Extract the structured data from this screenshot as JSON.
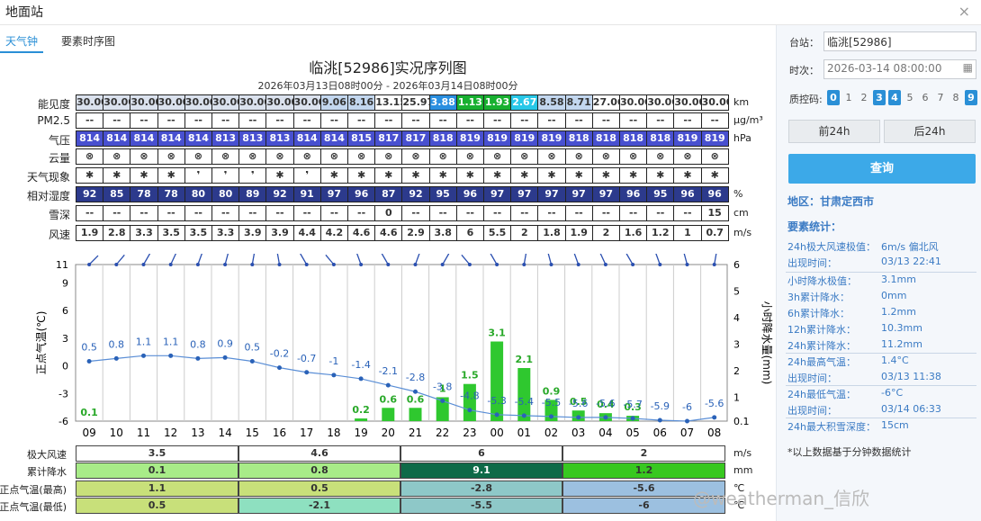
{
  "window": {
    "title": "地面站",
    "close": "×"
  },
  "tabs": [
    "天气钟",
    "要素时序图"
  ],
  "chart_title": "临洮[52986]实况序列图",
  "chart_subtitle": "2026年03月13日08时00分 - 2026年03月14日08时00分",
  "hours": [
    "09",
    "10",
    "11",
    "12",
    "13",
    "14",
    "15",
    "16",
    "17",
    "18",
    "19",
    "20",
    "21",
    "22",
    "23",
    "00",
    "01",
    "02",
    "03",
    "04",
    "05",
    "06",
    "07",
    "08"
  ],
  "rows": [
    {
      "label": "能见度",
      "unit": "km",
      "values": [
        "30.00",
        "30.00",
        "30.00",
        "30.00",
        "30.00",
        "30.00",
        "30.00",
        "30.00",
        "30.00",
        "9.06",
        "8.16",
        "13.15",
        "25.97",
        "3.88",
        "1.13",
        "1.93",
        "2.67",
        "8.58",
        "8.71",
        "27.06",
        "30.00",
        "30.00",
        "30.00",
        "30.00"
      ],
      "colors": [
        "#dbe2ee",
        "#dbe2ee",
        "#dbe2ee",
        "#dbe2ee",
        "#dbe2ee",
        "#dbe2ee",
        "#dbe2ee",
        "#dbe2ee",
        "#dbe2ee",
        "#c3d7ef",
        "#c3d7ef",
        "#ffffff",
        "#ffffff",
        "#2a8fe0",
        "#18b030",
        "#18b030",
        "#28c8e8",
        "#c3d7ef",
        "#c3d7ef",
        "#ffffff",
        "#ffffff",
        "#ffffff",
        "#ffffff",
        "#ffffff"
      ]
    },
    {
      "label": "PM2.5",
      "unit": "μg/m³",
      "values": [
        "--",
        "--",
        "--",
        "--",
        "--",
        "--",
        "--",
        "--",
        "--",
        "--",
        "--",
        "--",
        "--",
        "--",
        "--",
        "--",
        "--",
        "--",
        "--",
        "--",
        "--",
        "--",
        "--",
        "--"
      ]
    },
    {
      "label": "气压",
      "unit": "hPa",
      "values": [
        "814",
        "814",
        "814",
        "814",
        "814",
        "813",
        "813",
        "813",
        "814",
        "814",
        "815",
        "817",
        "817",
        "818",
        "819",
        "819",
        "819",
        "819",
        "818",
        "818",
        "818",
        "818",
        "819",
        "819"
      ],
      "fill": "#4850d0",
      "fg": "#fff"
    },
    {
      "label": "云量",
      "unit": "",
      "values": [
        "⊗",
        "⊗",
        "⊗",
        "⊗",
        "⊗",
        "⊗",
        "⊗",
        "⊗",
        "⊗",
        "⊗",
        "⊗",
        "⊗",
        "⊗",
        "⊗",
        "⊗",
        "⊗",
        "⊗",
        "⊗",
        "⊗",
        "⊗",
        "⊗",
        "⊗",
        "⊗",
        "⊗"
      ]
    },
    {
      "label": "天气现象",
      "unit": "",
      "values": [
        "✱",
        "✱",
        "✱",
        "✱",
        "❜",
        "❜",
        "❜",
        "✱",
        "❜",
        "✱",
        "✱",
        "✱",
        "✱",
        "✱",
        "✱",
        "✱",
        "✱",
        "✱",
        "✱",
        "✱",
        "✱",
        "✱",
        "✱",
        "✱"
      ]
    },
    {
      "label": "相对湿度",
      "unit": "%",
      "values": [
        "92",
        "85",
        "78",
        "78",
        "80",
        "80",
        "89",
        "92",
        "91",
        "97",
        "96",
        "87",
        "92",
        "95",
        "96",
        "97",
        "97",
        "97",
        "97",
        "97",
        "96",
        "95",
        "96",
        "96"
      ],
      "fill": "#2c3a8c",
      "fg": "#fff"
    },
    {
      "label": "雪深",
      "unit": "cm",
      "values": [
        "--",
        "--",
        "--",
        "--",
        "--",
        "--",
        "--",
        "--",
        "--",
        "--",
        "--",
        "0",
        "--",
        "--",
        "--",
        "--",
        "--",
        "--",
        "--",
        "--",
        "--",
        "--",
        "--",
        "15"
      ]
    },
    {
      "label": "风速",
      "unit": "m/s",
      "values": [
        "1.9",
        "2.8",
        "3.3",
        "3.5",
        "3.5",
        "3.3",
        "3.9",
        "3.9",
        "4.4",
        "4.2",
        "4.6",
        "4.6",
        "2.9",
        "3.8",
        "6",
        "5.5",
        "2",
        "1.8",
        "1.9",
        "2",
        "1.6",
        "1.2",
        "1",
        "0.7"
      ]
    }
  ],
  "chart_data": {
    "type": "line",
    "x": [
      "09",
      "10",
      "11",
      "12",
      "13",
      "14",
      "15",
      "16",
      "17",
      "18",
      "19",
      "20",
      "21",
      "22",
      "23",
      "00",
      "01",
      "02",
      "03",
      "04",
      "05",
      "06",
      "07",
      "08"
    ],
    "temperature": [
      0.5,
      0.8,
      1.1,
      1.1,
      0.8,
      0.9,
      0.5,
      -0.2,
      -0.7,
      -1,
      -1.4,
      -2.1,
      -2.8,
      -3.8,
      -4.8,
      -5.3,
      -5.4,
      -5.5,
      -5.6,
      -5.6,
      -5.7,
      -5.9,
      -6,
      -5.6
    ],
    "precip": [
      0.1,
      0,
      0,
      0,
      0,
      0,
      0,
      0,
      0,
      0,
      0.2,
      0.6,
      0.6,
      1,
      1.5,
      3.1,
      2.1,
      0.9,
      0.5,
      0.4,
      0.3,
      0,
      0,
      0
    ],
    "left_axis": {
      "label": "正点气温(℃)",
      "ticks": [
        11,
        9,
        6,
        3,
        0,
        -3,
        -6
      ]
    },
    "right_axis": {
      "label": "小时降水量(mm)",
      "ticks": [
        6,
        5,
        4,
        3,
        2,
        1,
        0.1
      ]
    }
  },
  "bottom_rows": [
    {
      "label": "极大风速",
      "unit": "m/s",
      "values": [
        "3.5",
        "4.6",
        "6",
        "2"
      ],
      "colors": [
        "#ffffff",
        "#ffffff",
        "#ffffff",
        "#ffffff"
      ]
    },
    {
      "label": "累计降水",
      "unit": "mm",
      "values": [
        "0.1",
        "0.8",
        "9.1",
        "1.2"
      ],
      "colors": [
        "#a8ec88",
        "#a8ec88",
        "#0e6a48",
        "#38c820"
      ]
    },
    {
      "label": "正点气温(最高)",
      "unit": "℃",
      "values": [
        "1.1",
        "0.5",
        "-2.8",
        "-5.6"
      ],
      "colors": [
        "#c8e07a",
        "#c8e07a",
        "#8ec8c8",
        "#9cc0e0"
      ]
    },
    {
      "label": "正点气温(最低)",
      "unit": "℃",
      "values": [
        "0.5",
        "-2.1",
        "-5.5",
        "-6"
      ],
      "colors": [
        "#c8e07a",
        "#8ee0c0",
        "#8ec8c8",
        "#9cc0e0"
      ]
    }
  ],
  "panel": {
    "station_label": "台站：",
    "station_value": "临洮[52986]",
    "time_label": "时次：",
    "time_value": "2026-03-14 08:00:00",
    "qc_label": "质控码:",
    "qc": [
      "0",
      "1",
      "2",
      "3",
      "4",
      "5",
      "6",
      "7",
      "8",
      "9"
    ],
    "qc_on": [
      true,
      false,
      false,
      true,
      true,
      false,
      false,
      false,
      false,
      true
    ],
    "prev": "前24h",
    "next": "后24h",
    "query": "查询",
    "area": "地区：甘肃定西市",
    "stats_title": "要素统计：",
    "stats": [
      {
        "k": "24h极大风速极值：",
        "v": "6m/s 偏北风"
      },
      {
        "k": "出现时间：",
        "v": "03/13 22:41"
      },
      {
        "k": "小时降水极值：",
        "v": "3.1mm"
      },
      {
        "k": "3h累计降水：",
        "v": "0mm"
      },
      {
        "k": "6h累计降水：",
        "v": "1.2mm"
      },
      {
        "k": "12h累计降水：",
        "v": "10.3mm"
      },
      {
        "k": "24h累计降水：",
        "v": "11.2mm"
      },
      {
        "k": "24h最高气温：",
        "v": "1.4°C"
      },
      {
        "k": "出现时间：",
        "v": "03/13 11:38"
      },
      {
        "k": "24h最低气温：",
        "v": "-6°C"
      },
      {
        "k": "出现时间：",
        "v": "03/14 06:33"
      },
      {
        "k": "24h最大积雪深度：",
        "v": "15cm"
      }
    ],
    "note": "*以上数据基于分钟数据统计"
  },
  "watermark": "@weatherman_信欣"
}
